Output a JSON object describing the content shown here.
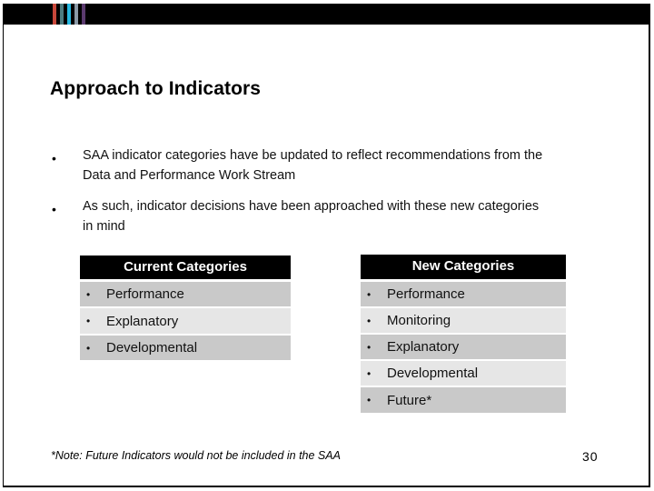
{
  "header": {
    "stripe_colors": [
      "#c8473a",
      "#4d7c80",
      "#25b7df",
      "#8b9aa7",
      "#5a3a6e"
    ]
  },
  "slide": {
    "title": "Approach to Indicators",
    "bullets": [
      {
        "marker": "•",
        "line1": "SAA indicator categories have be updated to reflect recommendations from the",
        "line2": "Data and Performance Work Stream"
      },
      {
        "marker": "•",
        "line1": "As such, indicator decisions have been approached with these new categories",
        "line2": "in mind"
      }
    ],
    "current_categories": {
      "header": "Current Categories",
      "items": [
        "Performance",
        "Explanatory",
        "Developmental"
      ]
    },
    "new_categories": {
      "header": "New Categories",
      "items": [
        "Performance",
        "Monitoring",
        "Explanatory",
        "Developmental",
        "Future*"
      ]
    },
    "item_marker": "•",
    "note": "*Note: Future Indicators would not be included in the SAA",
    "page_number": "30"
  }
}
